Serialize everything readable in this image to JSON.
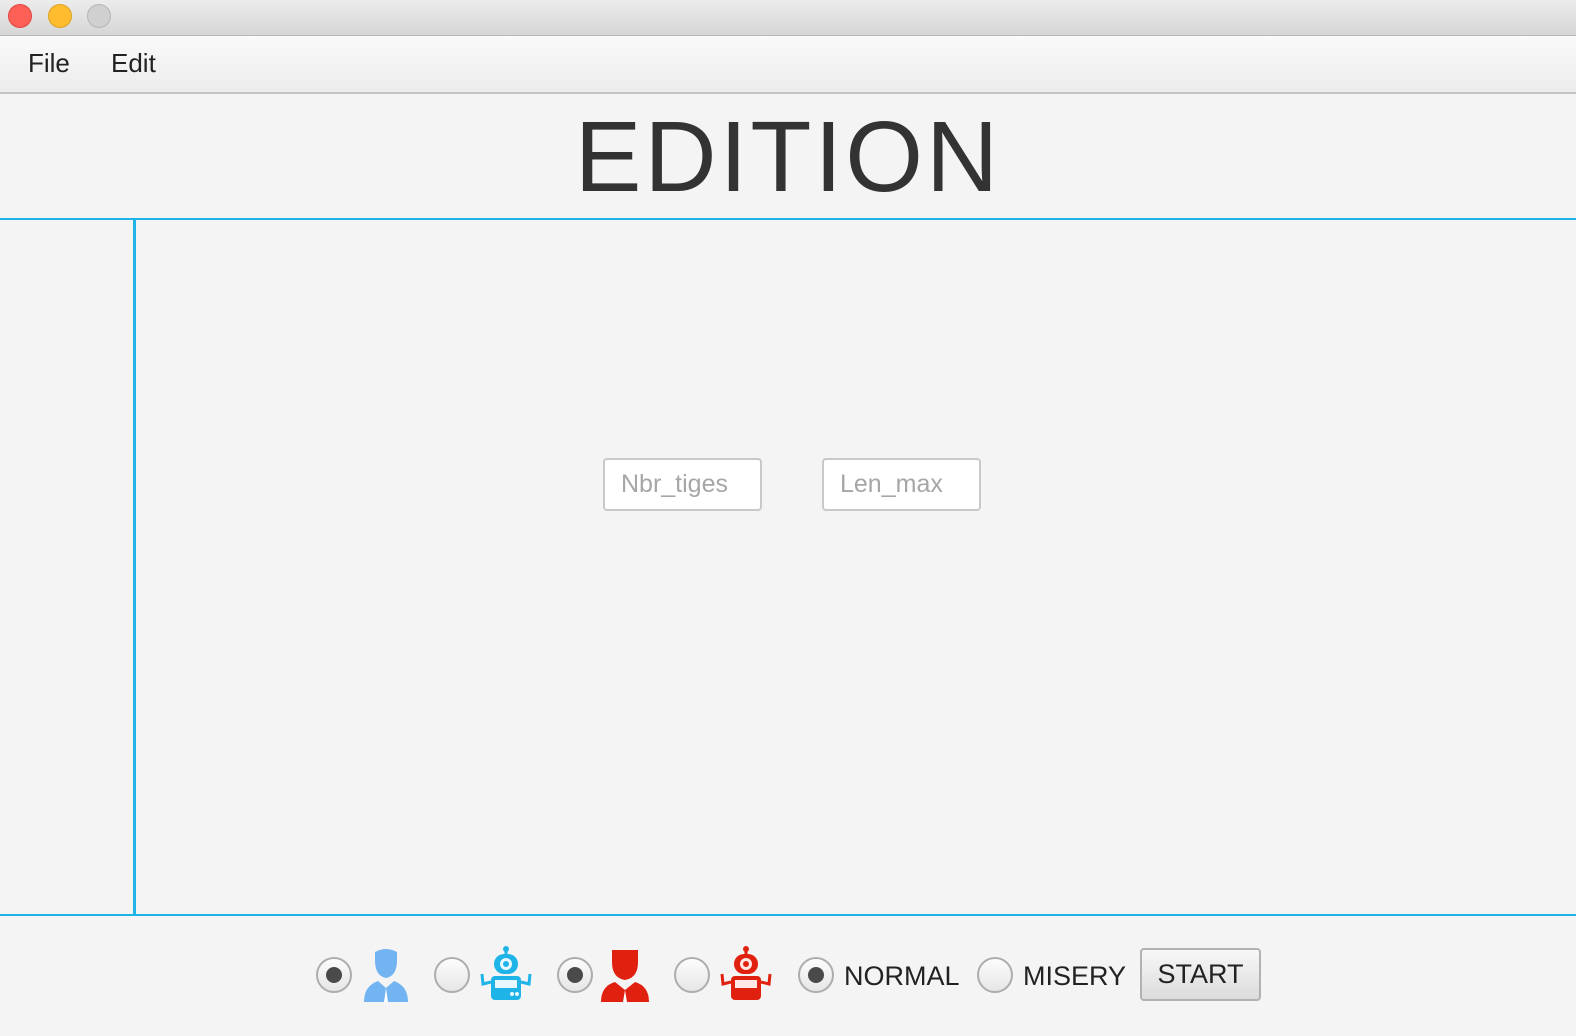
{
  "window": {
    "controls": [
      "close",
      "minimize",
      "maximize"
    ]
  },
  "menu": {
    "file": "File",
    "edit": "Edit"
  },
  "header": {
    "title": "EDITION"
  },
  "fields": {
    "nbr_tiges": {
      "value": "",
      "placeholder": "Nbr_tiges"
    },
    "len_max": {
      "value": "",
      "placeholder": "Len_max"
    }
  },
  "player1": {
    "human": {
      "selected": true,
      "icon": "human-player-icon",
      "color": "#72b3f2"
    },
    "robot": {
      "selected": false,
      "icon": "robot-player-icon",
      "color": "#1fb4e8"
    }
  },
  "player2": {
    "human": {
      "selected": true,
      "icon": "human-player-icon",
      "color": "#e0210f"
    },
    "robot": {
      "selected": false,
      "icon": "robot-player-icon",
      "color": "#e0210f"
    }
  },
  "mode": {
    "normal": {
      "label": "NORMAL",
      "selected": true
    },
    "misery": {
      "label": "MISERY",
      "selected": false
    }
  },
  "start": {
    "label": "START"
  },
  "colors": {
    "accent_line": "#1fb4e8",
    "background": "#f4f4f4"
  }
}
